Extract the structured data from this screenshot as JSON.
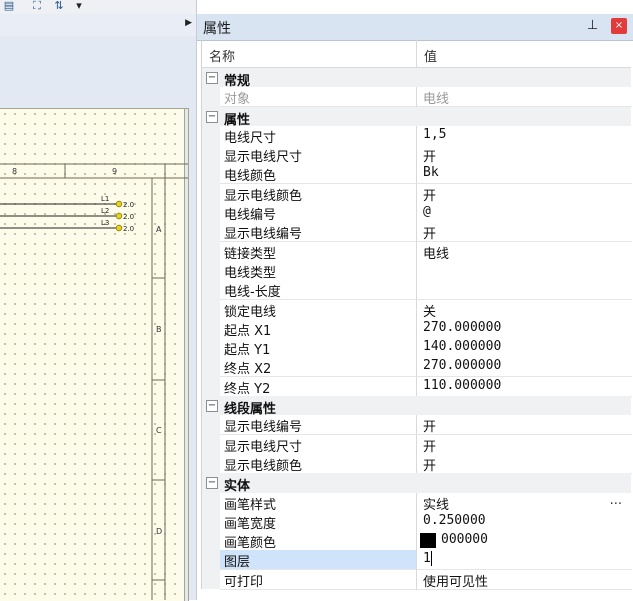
{
  "toolbar": {
    "icons": [
      "table-icon",
      "hierarchy-icon",
      "sort-icon",
      "dropdown-arrow-icon"
    ]
  },
  "drawing": {
    "columns": [
      "8",
      "9"
    ],
    "rows": [
      "A",
      "B",
      "C",
      "D"
    ],
    "wires": [
      {
        "label": "L1",
        "value": "2.0"
      },
      {
        "label": "L2",
        "value": "2.0"
      },
      {
        "label": "L3",
        "value": "2.0"
      }
    ]
  },
  "panel": {
    "title": "属性",
    "pin": "📌",
    "close": "×",
    "header_name": "名称",
    "header_value": "值"
  },
  "sections": [
    {
      "label": "常规",
      "rows": [
        {
          "name": "对象",
          "value": "电线",
          "disabled": true
        }
      ]
    },
    {
      "label": "属性",
      "rows": [
        {
          "name": "电线尺寸",
          "value": "1,5"
        },
        {
          "name": "显示电线尺寸",
          "value": "开"
        },
        {
          "name": "电线颜色",
          "value": "Bk"
        },
        {
          "name": "显示电线颜色",
          "value": "开"
        },
        {
          "name": "电线编号",
          "value": "@"
        },
        {
          "name": "显示电线编号",
          "value": "开"
        },
        {
          "name": "链接类型",
          "value": "电线"
        },
        {
          "name": "电线类型",
          "value": ""
        },
        {
          "name": "电线-长度",
          "value": ""
        },
        {
          "name": "锁定电线",
          "value": "关"
        },
        {
          "name": "起点 X1",
          "value": "270.000000"
        },
        {
          "name": "起点 Y1",
          "value": "140.000000"
        },
        {
          "name": "终点 X2",
          "value": "270.000000"
        },
        {
          "name": "终点 Y2",
          "value": "110.000000"
        }
      ]
    },
    {
      "label": "线段属性",
      "rows": [
        {
          "name": "显示电线编号",
          "value": "开"
        },
        {
          "name": "显示电线尺寸",
          "value": "开"
        },
        {
          "name": "显示电线颜色",
          "value": "开"
        }
      ]
    },
    {
      "label": "实体",
      "rows": [
        {
          "name": "画笔样式",
          "value": "实线",
          "ellipsis": "..."
        },
        {
          "name": "画笔宽度",
          "value": "0.250000"
        },
        {
          "name": "画笔颜色",
          "value": "000000",
          "swatch": "#000000"
        },
        {
          "name": "图层",
          "value": "1",
          "selected": true
        },
        {
          "name": "可打印",
          "value": "使用可见性"
        }
      ]
    }
  ],
  "colors": {
    "header_bg": "#d9e4f3",
    "selected_bg": "#cfe4fa",
    "close_red": "#e23b3b",
    "sheet_bg": "#fdfbea",
    "wire_marker": "#e8d21a"
  }
}
